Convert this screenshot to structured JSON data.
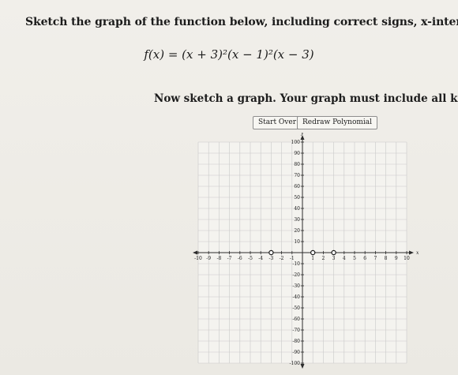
{
  "question": {
    "prompt": "Sketch the graph of the function below, including correct signs, x-intercepts and y-interce",
    "equation": "f(x) = (x + 3)²(x − 1)²(x − 3)",
    "instruction": "Now sketch a graph. Your graph must include all known intercepts."
  },
  "buttons": {
    "start_over": "Start Over",
    "redraw": "Redraw Polynomial"
  },
  "graph": {
    "x_axis_label": "x",
    "y_axis_label": "y",
    "x_range": [
      -10,
      10
    ],
    "y_range": [
      -100,
      100
    ],
    "x_ticks": [
      -10,
      -9,
      -8,
      -7,
      -6,
      -5,
      -4,
      -3,
      -2,
      -1,
      1,
      2,
      3,
      4,
      5,
      6,
      7,
      8,
      9,
      10
    ],
    "y_ticks": [
      100,
      90,
      80,
      70,
      60,
      50,
      40,
      30,
      20,
      10,
      -10,
      -20,
      -30,
      -40,
      -50,
      -60,
      -70,
      -80,
      -90,
      -100
    ],
    "intercept_points": [
      {
        "x": -3,
        "y": 0
      },
      {
        "x": 1,
        "y": 0
      },
      {
        "x": 3,
        "y": 0
      }
    ],
    "colors": {
      "grid": "#c9c9c9",
      "axis": "#2b2b2b",
      "point_fill": "#ffffff",
      "point_stroke": "#1a1a1a"
    }
  }
}
